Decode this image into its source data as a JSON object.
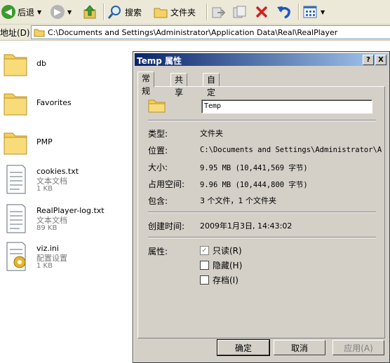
{
  "toolbar": {
    "back": "后退",
    "search": "搜索",
    "folders": "文件夹"
  },
  "address": {
    "label": "地址(D)",
    "path": "C:\\Documents and Settings\\Administrator\\Application Data\\Real\\RealPlayer"
  },
  "files": [
    {
      "name": "db",
      "type": "",
      "size": ""
    },
    {
      "name": "Favorites",
      "type": "",
      "size": ""
    },
    {
      "name": "PMP",
      "type": "",
      "size": ""
    },
    {
      "name": "cookies.txt",
      "type": "文本文档",
      "size": "1 KB"
    },
    {
      "name": "RealPlayer-log.txt",
      "type": "文本文档",
      "size": "89 KB"
    },
    {
      "name": "viz.ini",
      "type": "配置设置",
      "size": "1 KB"
    }
  ],
  "dialog": {
    "title": "Temp 属性",
    "help_btn": "?",
    "close_btn": "X",
    "tabs": [
      "常规",
      "共享",
      "自定义"
    ],
    "folder_name": "Temp",
    "rows": {
      "type_label": "类型:",
      "type_value": "文件夹",
      "location_label": "位置:",
      "location_value": "C:\\Documents and Settings\\Administrator\\A",
      "size_label": "大小:",
      "size_value": "9.95 MB (10,441,569 字节)",
      "disk_label": "占用空间:",
      "disk_value": "9.96 MB (10,444,800 字节)",
      "contains_label": "包含:",
      "contains_value": "3 个文件，1 个文件夹",
      "created_label": "创建时间:",
      "created_value": "2009年1月3日, 14:43:02",
      "attr_label": "属性:"
    },
    "attributes": [
      {
        "label": "只读(R)",
        "checked": true
      },
      {
        "label": "隐藏(H)",
        "checked": false
      },
      {
        "label": "存档(I)",
        "checked": false
      }
    ],
    "buttons": {
      "ok": "确定",
      "cancel": "取消",
      "apply": "应用(A)"
    }
  }
}
